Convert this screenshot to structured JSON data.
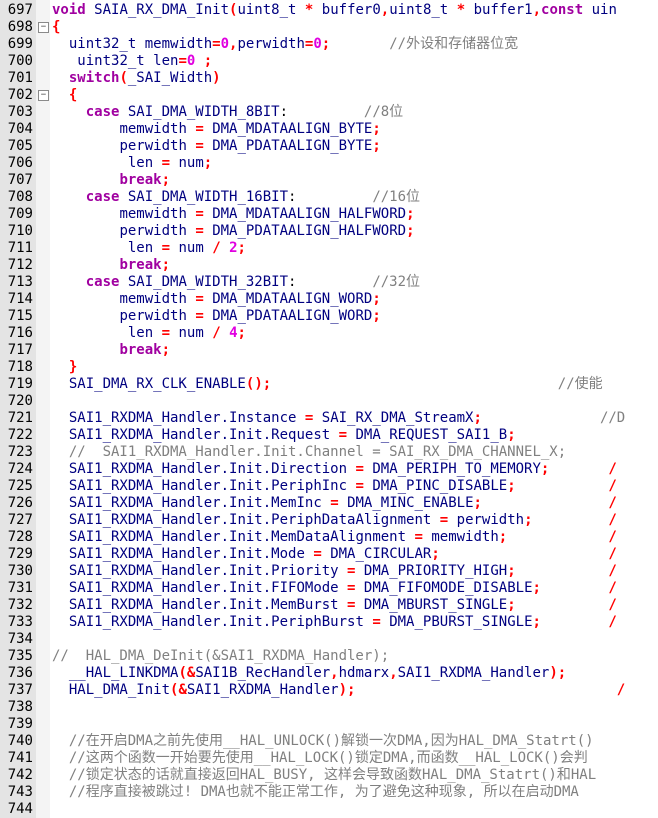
{
  "editor": {
    "colors": {
      "keyword": "#a000a0",
      "number": "#e000e0",
      "operator": "#ff0000",
      "comment": "#808080",
      "identifier": "#000080"
    },
    "lines": [
      {
        "num": "697",
        "text": "void SAIA_RX_DMA_Init(uint8_t * buffer0,uint8_t * buffer1,const uin"
      },
      {
        "num": "698",
        "text": "{",
        "fold": "−"
      },
      {
        "num": "699",
        "text": "  uint32_t memwidth=0,perwidth=0;       //外设和存储器位宽"
      },
      {
        "num": "700",
        "text": "   uint32_t len=0 ;"
      },
      {
        "num": "701",
        "text": "  switch(_SAI_Width)"
      },
      {
        "num": "702",
        "text": "  {",
        "fold": "−"
      },
      {
        "num": "703",
        "text": "    case SAI_DMA_WIDTH_8BIT:         //8位"
      },
      {
        "num": "704",
        "text": "        memwidth = DMA_MDATAALIGN_BYTE;"
      },
      {
        "num": "705",
        "text": "        perwidth = DMA_PDATAALIGN_BYTE;"
      },
      {
        "num": "706",
        "text": "         len = num;"
      },
      {
        "num": "707",
        "text": "        break;"
      },
      {
        "num": "708",
        "text": "    case SAI_DMA_WIDTH_16BIT:         //16位"
      },
      {
        "num": "709",
        "text": "        memwidth = DMA_MDATAALIGN_HALFWORD;"
      },
      {
        "num": "710",
        "text": "        perwidth = DMA_PDATAALIGN_HALFWORD;"
      },
      {
        "num": "711",
        "text": "         len = num / 2;"
      },
      {
        "num": "712",
        "text": "        break;"
      },
      {
        "num": "713",
        "text": "    case SAI_DMA_WIDTH_32BIT:         //32位"
      },
      {
        "num": "714",
        "text": "        memwidth = DMA_MDATAALIGN_WORD;"
      },
      {
        "num": "715",
        "text": "        perwidth = DMA_PDATAALIGN_WORD;"
      },
      {
        "num": "716",
        "text": "         len = num / 4;"
      },
      {
        "num": "717",
        "text": "        break;"
      },
      {
        "num": "718",
        "text": "  }"
      },
      {
        "num": "719",
        "text": "  SAI_DMA_RX_CLK_ENABLE();                                  //使能"
      },
      {
        "num": "720",
        "text": ""
      },
      {
        "num": "721",
        "text": "  SAI1_RXDMA_Handler.Instance = SAI_RX_DMA_StreamX;              //D"
      },
      {
        "num": "722",
        "text": "  SAI1_RXDMA_Handler.Init.Request = DMA_REQUEST_SAI1_B;"
      },
      {
        "num": "723",
        "text": "  //  SAI1_RXDMA_Handler.Init.Channel = SAI_RX_DMA_CHANNEL_X;"
      },
      {
        "num": "724",
        "text": "  SAI1_RXDMA_Handler.Init.Direction = DMA_PERIPH_TO_MEMORY;       /"
      },
      {
        "num": "725",
        "text": "  SAI1_RXDMA_Handler.Init.PeriphInc = DMA_PINC_DISABLE;           /"
      },
      {
        "num": "726",
        "text": "  SAI1_RXDMA_Handler.Init.MemInc = DMA_MINC_ENABLE;               /"
      },
      {
        "num": "727",
        "text": "  SAI1_RXDMA_Handler.Init.PeriphDataAlignment = perwidth;         /"
      },
      {
        "num": "728",
        "text": "  SAI1_RXDMA_Handler.Init.MemDataAlignment = memwidth;            /"
      },
      {
        "num": "729",
        "text": "  SAI1_RXDMA_Handler.Init.Mode = DMA_CIRCULAR;                    /"
      },
      {
        "num": "730",
        "text": "  SAI1_RXDMA_Handler.Init.Priority = DMA_PRIORITY_HIGH;           /"
      },
      {
        "num": "731",
        "text": "  SAI1_RXDMA_Handler.Init.FIFOMode = DMA_FIFOMODE_DISABLE;        /"
      },
      {
        "num": "732",
        "text": "  SAI1_RXDMA_Handler.Init.MemBurst = DMA_MBURST_SINGLE;           /"
      },
      {
        "num": "733",
        "text": "  SAI1_RXDMA_Handler.Init.PeriphBurst = DMA_PBURST_SINGLE;        /"
      },
      {
        "num": "734",
        "text": ""
      },
      {
        "num": "735",
        "text": "//  HAL_DMA_DeInit(&SAI1_RXDMA_Handler);"
      },
      {
        "num": "736",
        "text": "  __HAL_LINKDMA(&SAI1B_RecHandler,hdmarx,SAI1_RXDMA_Handler);"
      },
      {
        "num": "737",
        "text": "  HAL_DMA_Init(&SAI1_RXDMA_Handler);                               /"
      },
      {
        "num": "738",
        "text": ""
      },
      {
        "num": "739",
        "text": ""
      },
      {
        "num": "740",
        "text": "  //在开启DMA之前先使用__HAL_UNLOCK()解锁一次DMA,因为HAL_DMA_Statrt()"
      },
      {
        "num": "741",
        "text": "  //这两个函数一开始要先使用__HAL_LOCK()锁定DMA,而函数__HAL_LOCK()会判"
      },
      {
        "num": "742",
        "text": "  //锁定状态的话就直接返回HAL_BUSY, 这样会导致函数HAL_DMA_Statrt()和HAL"
      },
      {
        "num": "743",
        "text": "  //程序直接被跳过! DMA也就不能正常工作, 为了避免这种现象, 所以在启动DMA"
      },
      {
        "num": "744",
        "text": ""
      }
    ]
  }
}
